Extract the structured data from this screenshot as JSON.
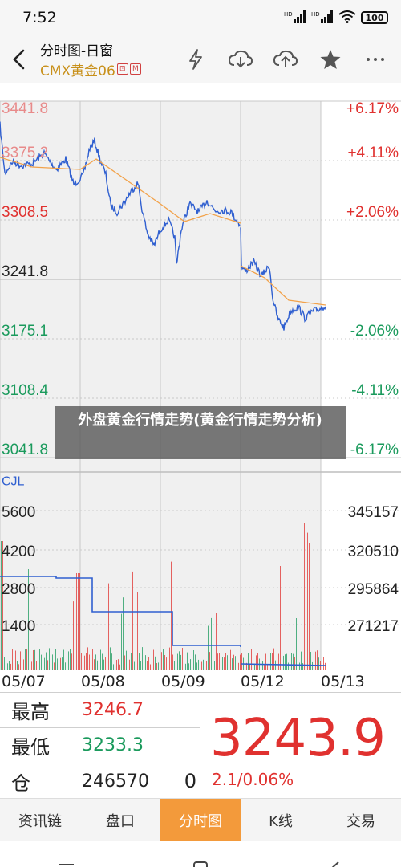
{
  "status": {
    "time": "7:52",
    "battery": "100",
    "net1": "HD",
    "net2": "HD"
  },
  "header": {
    "title": "分时图-日窗",
    "subtitle": "CMX黄金06",
    "badge": "M"
  },
  "chart": {
    "price_left": [
      "3441.8",
      "3375.2",
      "3308.5",
      "3241.8",
      "3175.1",
      "3108.4",
      "3041.8"
    ],
    "pct_right": [
      "+6.17%",
      "+4.11%",
      "+2.06%",
      "",
      "-2.06%",
      "-4.11%",
      "-6.17%"
    ],
    "volume_title": "CJL",
    "vol_left": [
      "5600",
      "4200",
      "2800",
      "1400"
    ],
    "vol_right": [
      "345157",
      "320510",
      "295864",
      "271217"
    ],
    "dates": [
      "05/07",
      "05/08",
      "05/09",
      "05/12",
      "05/13"
    ],
    "overlay_text": "外盘黄金行情走势(黄金行情走势分析)",
    "colors": {
      "up": "#e0312f",
      "down": "#1a9a5c",
      "price_line": "#2f5fd0",
      "avg_line": "#f2a24a"
    }
  },
  "chart_data": {
    "type": "line",
    "x": [
      "05/07",
      "05/08",
      "05/09",
      "05/12",
      "05/13"
    ],
    "series": [],
    "ylim": [
      3041.8,
      3441.8
    ],
    "grid": true
  },
  "info": {
    "high_label": "最高",
    "high_value": "3246.7",
    "low_label": "最低",
    "low_value": "3233.3",
    "pos_label": "仓",
    "pos_value": "246570",
    "pos_change": "0",
    "last_price": "3243.9",
    "change": "2.1/0.06%"
  },
  "tabs": [
    "资讯链",
    "盘口",
    "分时图",
    "K线",
    "交易"
  ]
}
